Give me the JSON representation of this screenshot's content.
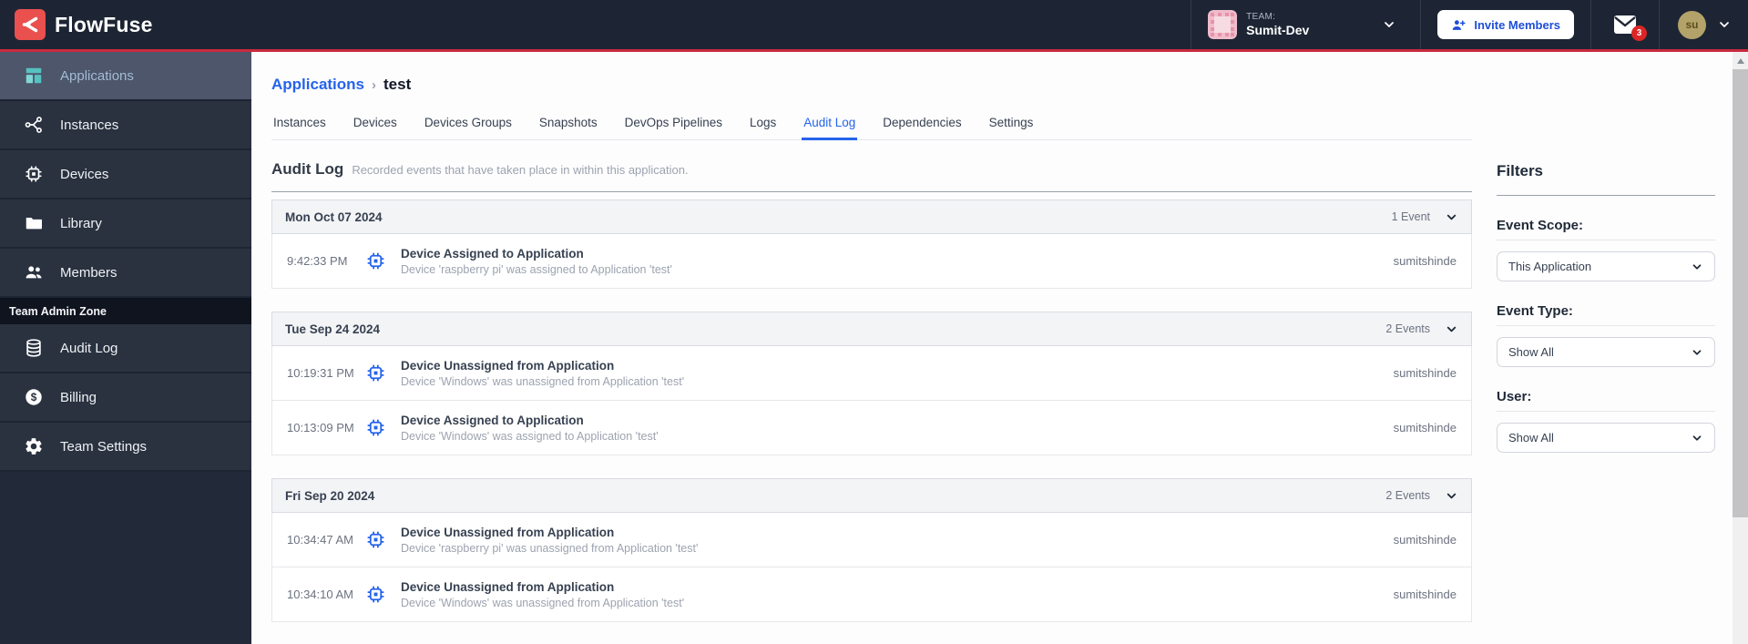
{
  "brand": {
    "name": "FlowFuse"
  },
  "navbar": {
    "team_label": "TEAM:",
    "team_name": "Sumit-Dev",
    "invite_label": "Invite Members",
    "notification_count": "3",
    "user_initials": "su"
  },
  "sidebar": {
    "items": [
      {
        "icon": "applications",
        "label": "Applications",
        "active": true
      },
      {
        "icon": "instances",
        "label": "Instances",
        "active": false
      },
      {
        "icon": "devices",
        "label": "Devices",
        "active": false
      },
      {
        "icon": "library",
        "label": "Library",
        "active": false
      },
      {
        "icon": "members",
        "label": "Members",
        "active": false
      }
    ],
    "admin_zone_label": "Team Admin Zone",
    "admin_items": [
      {
        "icon": "audit-log",
        "label": "Audit Log",
        "active": false
      },
      {
        "icon": "billing",
        "label": "Billing",
        "active": false
      },
      {
        "icon": "team-settings",
        "label": "Team Settings",
        "active": false
      }
    ]
  },
  "breadcrumb": {
    "parent": "Applications",
    "separator": "›",
    "current": "test"
  },
  "tabs": [
    {
      "label": "Instances",
      "active": false
    },
    {
      "label": "Devices",
      "active": false
    },
    {
      "label": "Devices Groups",
      "active": false
    },
    {
      "label": "Snapshots",
      "active": false
    },
    {
      "label": "DevOps Pipelines",
      "active": false
    },
    {
      "label": "Logs",
      "active": false
    },
    {
      "label": "Audit Log",
      "active": true
    },
    {
      "label": "Dependencies",
      "active": false
    },
    {
      "label": "Settings",
      "active": false
    }
  ],
  "audit": {
    "title": "Audit Log",
    "subtitle": "Recorded events that have taken place in within this application.",
    "groups": [
      {
        "date": "Mon Oct 07 2024",
        "count_label": "1 Event",
        "events": [
          {
            "time": "9:42:33 PM",
            "title": "Device Assigned to Application",
            "description": "Device 'raspberry pi' was assigned to Application 'test'",
            "user": "sumitshinde"
          }
        ]
      },
      {
        "date": "Tue Sep 24 2024",
        "count_label": "2 Events",
        "events": [
          {
            "time": "10:19:31 PM",
            "title": "Device Unassigned from Application",
            "description": "Device 'Windows' was unassigned from Application 'test'",
            "user": "sumitshinde"
          },
          {
            "time": "10:13:09 PM",
            "title": "Device Assigned to Application",
            "description": "Device 'Windows' was assigned to Application 'test'",
            "user": "sumitshinde"
          }
        ]
      },
      {
        "date": "Fri Sep 20 2024",
        "count_label": "2 Events",
        "events": [
          {
            "time": "10:34:47 AM",
            "title": "Device Unassigned from Application",
            "description": "Device 'raspberry pi' was unassigned from Application 'test'",
            "user": "sumitshinde"
          },
          {
            "time": "10:34:10 AM",
            "title": "Device Unassigned from Application",
            "description": "Device 'Windows' was unassigned from Application 'test'",
            "user": "sumitshinde"
          }
        ]
      }
    ]
  },
  "filters": {
    "title": "Filters",
    "fields": [
      {
        "label": "Event Scope:",
        "value": "This Application"
      },
      {
        "label": "Event Type:",
        "value": "Show All"
      },
      {
        "label": "User:",
        "value": "Show All"
      }
    ]
  },
  "colors": {
    "accent_blue": "#2563eb",
    "navbar_bg": "#1d2534",
    "red_line": "#cb2a3e",
    "badge_red": "#dc2626",
    "sidebar_active_bg": "#4d566a",
    "teal_icon": "#56c1c1"
  }
}
